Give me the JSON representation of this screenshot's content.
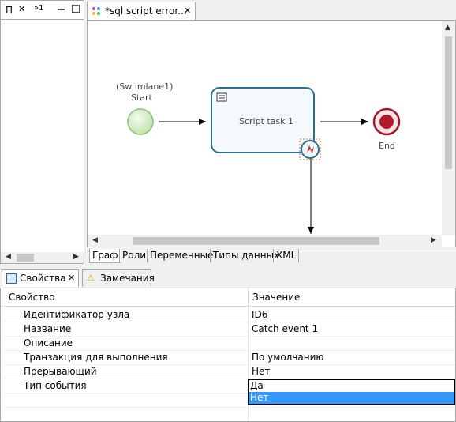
{
  "left_view": {
    "tab1_label": "П",
    "tab2_label": "»1"
  },
  "editor": {
    "tab_label": "*sql script error...",
    "diagram": {
      "start_lane": "(Sw imlane1)",
      "start_label": "Start",
      "task_label": "Script task 1",
      "end_label": "End"
    },
    "bottom_tabs": [
      "Граф",
      "Роли",
      "Переменные",
      "Типы данных",
      "XML"
    ]
  },
  "properties": {
    "tabs": [
      "Свойства",
      "Замечания"
    ],
    "header": {
      "property": "Свойство",
      "value": "Значение"
    },
    "rows": [
      {
        "property": "Идентификатор узла",
        "value": "ID6"
      },
      {
        "property": "Название",
        "value": "Catch event 1"
      },
      {
        "property": "Описание",
        "value": ""
      },
      {
        "property": "Транзакция для выполнения",
        "value": "По умолчанию"
      },
      {
        "property": "Прерывающий",
        "value": "Нет"
      },
      {
        "property": "Тип события",
        "value": ""
      }
    ],
    "dropdown_options": [
      "Да",
      "Нет"
    ],
    "dropdown_selected": "Нет"
  },
  "colors": {
    "start_fill": "#d8f0c0",
    "start_stroke": "#7fb56a",
    "task_stroke": "#2e6e8e",
    "end_fill": "#b01a2a",
    "selection": "#3399ff"
  }
}
